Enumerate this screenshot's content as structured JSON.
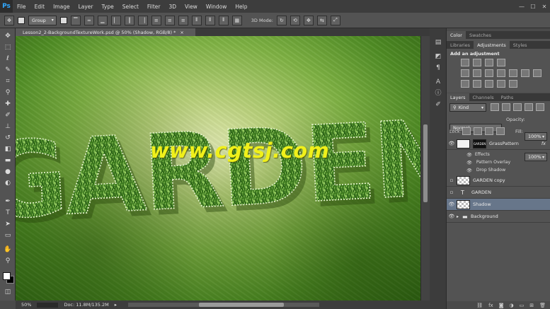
{
  "app": {
    "logo": "Ps"
  },
  "menu": [
    "File",
    "Edit",
    "Image",
    "Layer",
    "Type",
    "Select",
    "Filter",
    "3D",
    "View",
    "Window",
    "Help"
  ],
  "window_controls": [
    "—",
    "☐",
    "✕"
  ],
  "options": {
    "auto_select_value": "Group",
    "mode_label": "3D Mode:"
  },
  "document": {
    "tab_title": "Lesson2_2-BackgroundTextureWork.psd @ 50% (Shadow, RGB/8) *",
    "tab_close": "×",
    "artwork_text": "GARDEN",
    "watermark": "www.cgtsj.com"
  },
  "status": {
    "zoom": "50%",
    "doc_info": "Doc: 11.8M/135.2M",
    "arrow": "▸"
  },
  "color_panel": {
    "tabs": [
      "Color",
      "Swatches"
    ]
  },
  "adjustments_panel": {
    "tabs": [
      "Libraries",
      "Adjustments",
      "Styles"
    ],
    "heading": "Add an adjustment"
  },
  "layers_panel": {
    "tabs": [
      "Layers",
      "Channels",
      "Paths"
    ],
    "filter_label": "Kind",
    "blend_mode": "Normal",
    "opacity_label": "Opacity:",
    "opacity_value": "100%",
    "lock_label": "Lock:",
    "fill_label": "Fill:",
    "fill_value": "100%",
    "layers": [
      {
        "name": "GrassPattern",
        "fx": "fx",
        "mask_label": "GARDEN"
      },
      {
        "name": "GARDEN copy"
      },
      {
        "name": "GARDEN",
        "type_icon": "T"
      },
      {
        "name": "Shadow"
      },
      {
        "name": "Background"
      }
    ],
    "effects_label": "Effects",
    "effects": [
      "Pattern Overlay",
      "Drop Shadow"
    ]
  },
  "colors": {
    "grass": "#3f7a26",
    "watermark": "#f0f01a",
    "selected_layer": "#67768a"
  }
}
